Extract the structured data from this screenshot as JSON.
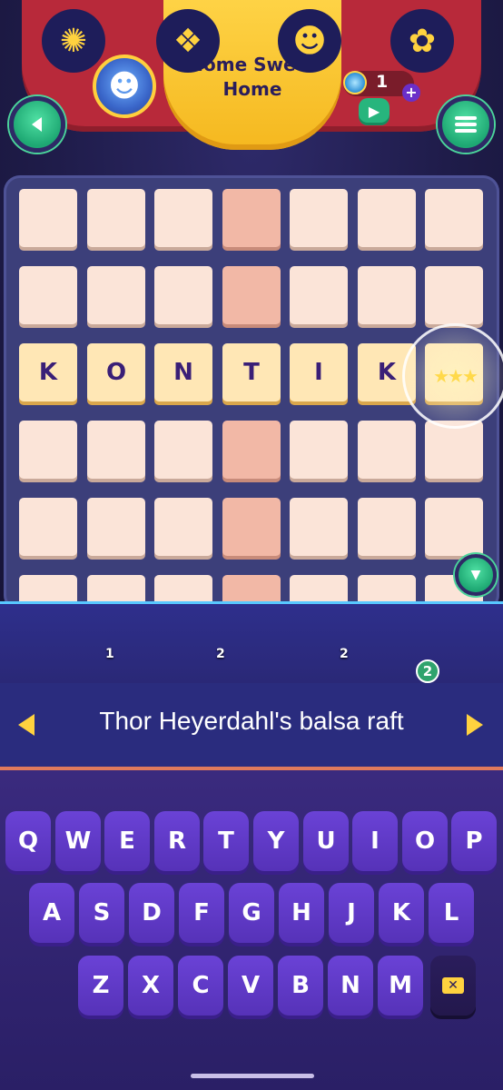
{
  "header": {
    "title": "Home Sweet Home",
    "coins": "1",
    "coin_plus": "+"
  },
  "buttons": {
    "back_icon": "chevron-left-icon",
    "menu_icon": "hamburger-menu-icon",
    "video_icon": "video-camera-icon",
    "scroll_down_icon": "chevron-down-icon"
  },
  "board": {
    "rows": 6,
    "cols": 7,
    "highlight_column": 4,
    "active_row": 3,
    "active_row_letters": [
      "K",
      "O",
      "N",
      "T",
      "I",
      "K",
      ""
    ]
  },
  "helpers": [
    {
      "name": "firefly-helper",
      "cost": "1"
    },
    {
      "name": "card-helper",
      "cost": "2"
    },
    {
      "name": "astronaut-helper",
      "cost": "2"
    },
    {
      "name": "worm-helper",
      "count": "2"
    }
  ],
  "clue": {
    "text": "Thor Heyerdahl's balsa raft"
  },
  "keyboard": {
    "row1": [
      "Q",
      "W",
      "E",
      "R",
      "T",
      "Y",
      "U",
      "I",
      "O",
      "P"
    ],
    "row2": [
      "A",
      "S",
      "D",
      "F",
      "G",
      "H",
      "J",
      "K",
      "L"
    ],
    "row3": [
      "Z",
      "X",
      "C",
      "V",
      "B",
      "N",
      "M"
    ],
    "backspace_icon": "backspace-icon"
  },
  "colors": {
    "header_red": "#b8293a",
    "header_yellow": "#ffd64a",
    "tile": "#fbe4d8",
    "tile_highlight": "#f2b8a6",
    "tile_active": "#ffe7b5",
    "key": "#6a42d6",
    "accent_green": "#1ea873"
  }
}
